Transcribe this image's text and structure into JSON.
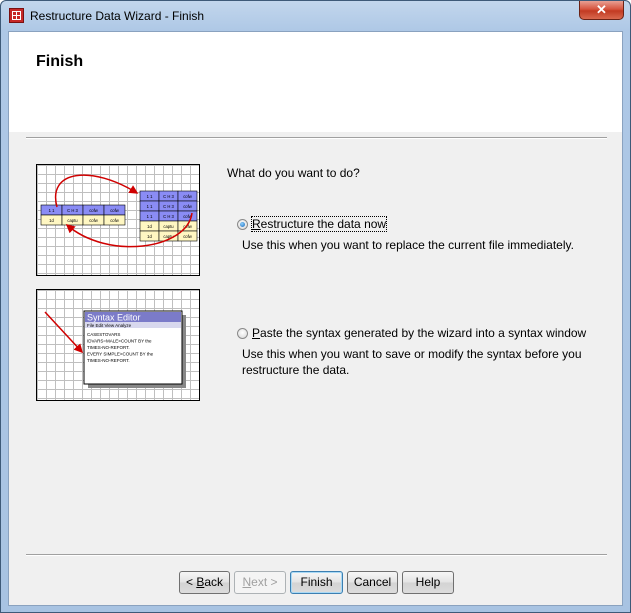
{
  "window": {
    "title": "Restructure Data Wizard - Finish",
    "close_glyph": "✕"
  },
  "page": {
    "title": "Finish",
    "question": "What do you want to do?"
  },
  "options": [
    {
      "prefix": "",
      "mnemonic": "R",
      "label_rest": "estructure the data now",
      "checked": true,
      "description": "Use this when you want to replace the current file immediately."
    },
    {
      "prefix": "",
      "mnemonic": "P",
      "label_rest": "aste the syntax generated by the wizard into a syntax window",
      "checked": false,
      "description": "Use this when you want to save or modify the syntax before you restructure the data."
    }
  ],
  "illustration1": {
    "source_cells": [
      "1 1",
      "C H 3",
      "cofw",
      "cofw",
      "1d",
      "captu",
      "cofw",
      "cofw"
    ],
    "target_cells": [
      "1 1",
      "C H 3",
      "cofw",
      "1 1",
      "C H 3",
      "cofw",
      "1 1",
      "C H 3",
      "cofw",
      "1d",
      "captu",
      "cofw",
      "1d",
      "captu",
      "cofw"
    ]
  },
  "illustration2": {
    "editor_title": "Syntax Editor",
    "editor_menu": "File  Edit  View  Analyze",
    "editor_lines": [
      "CASESTOVARS",
      "IDVARS=MALE>COUNT BY the",
      "TIMES-NO-REFORT.",
      "EVERY SIMPLE>COUNT BY the",
      "TIMES-NO-REFORT."
    ]
  },
  "buttons": {
    "back": {
      "prefix": "< ",
      "mnemonic": "B",
      "rest": "ack"
    },
    "next": {
      "mnemonic": "N",
      "rest": "ext >"
    },
    "finish": "Finish",
    "cancel": "Cancel",
    "help": "Help"
  },
  "colors": {
    "accent_blue": "#8a8cf5",
    "row_yellow": "#fff7c2",
    "arrow_red": "#d00000",
    "editor_title_bg": "#7b7bc9"
  }
}
